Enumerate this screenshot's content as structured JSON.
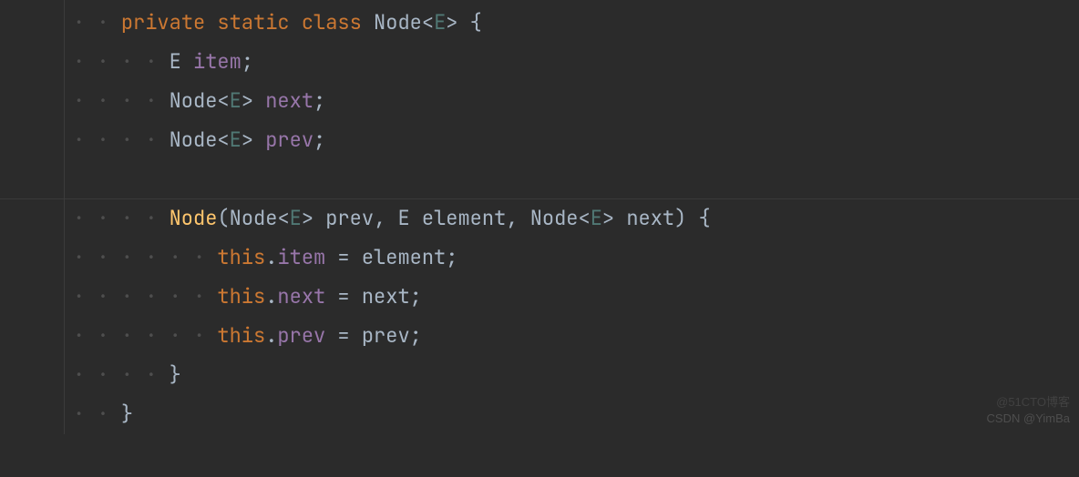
{
  "colors": {
    "bg": "#2b2b2b",
    "fg": "#a9b7c6",
    "keyword": "#cc7832",
    "generic": "#507874",
    "method": "#ffc66d",
    "field": "#9876aa",
    "whitespace": "#4e4e4e"
  },
  "watermark_top": "@51CTO博客",
  "watermark_bottom": "CSDN @YimBa",
  "code": {
    "kw_private": "private",
    "kw_static": "static",
    "kw_class": "class",
    "kw_this": "this",
    "type_Node": "Node",
    "type_E": "E",
    "generic_open": "<",
    "generic_close": ">",
    "field_item": "item",
    "field_next": "next",
    "field_prev": "prev",
    "ctor_name": "Node",
    "param_prev": "prev",
    "param_element": "element",
    "param_next": "next",
    "op_eq": " = ",
    "semi": ";",
    "dot": ".",
    "comma": ", ",
    "lbrace": "{",
    "rbrace": "}",
    "lparen": "(",
    "rparen": ")",
    "sp": " ",
    "indent1": "· · ",
    "indent2": "· · · · ",
    "indent3": "· · · · · · "
  }
}
